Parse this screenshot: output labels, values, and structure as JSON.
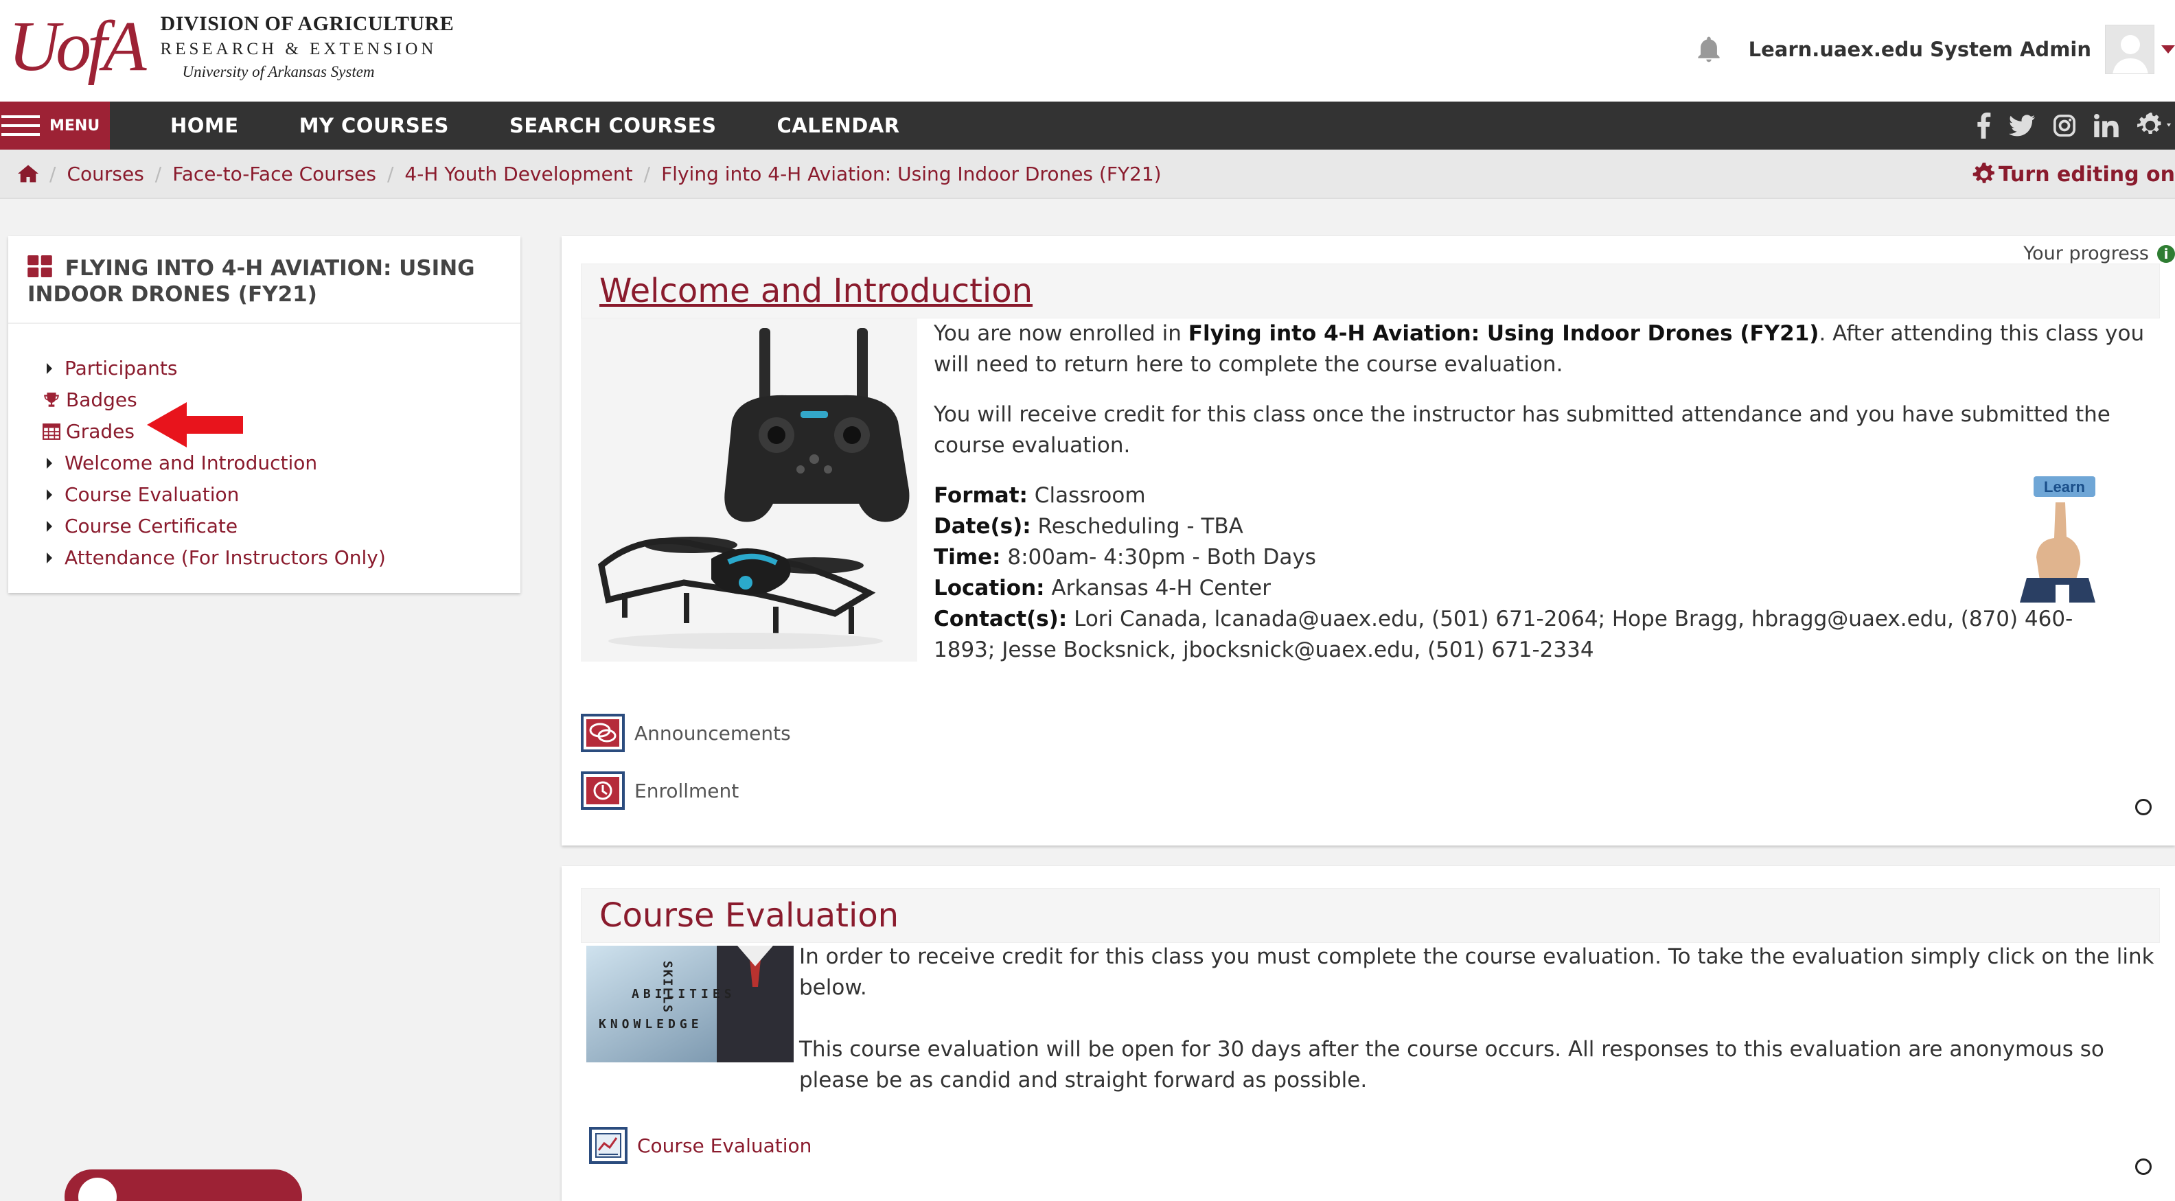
{
  "header": {
    "logo": {
      "mark": "UofA",
      "line1": "DIVISION OF AGRICULTURE",
      "line2": "RESEARCH & EXTENSION",
      "line3": "University of Arkansas System"
    },
    "user_name": "Learn.uaex.edu System Admin",
    "icons": {
      "bell": "bell-icon",
      "avatar": "user-avatar-icon",
      "caret": "caret-down-icon"
    }
  },
  "nav": {
    "menu_label": "MENU",
    "items": [
      "HOME",
      "MY COURSES",
      "SEARCH COURSES",
      "CALENDAR"
    ],
    "social": [
      "facebook-icon",
      "twitter-icon",
      "instagram-icon",
      "linkedin-icon",
      "gear-icon"
    ]
  },
  "breadcrumb": {
    "items": [
      "Courses",
      "Face-to-Face Courses",
      "4-H Youth Development",
      "Flying into 4-H Aviation: Using Indoor Drones (FY21)"
    ],
    "sep": "/",
    "edit_label": "Turn editing on"
  },
  "sidebar": {
    "title": "FLYING INTO 4-H AVIATION: USING INDOOR DRONES (FY21)",
    "items": [
      {
        "label": "Participants",
        "icon": "triangle-right-icon"
      },
      {
        "label": "Badges",
        "icon": "trophy-icon"
      },
      {
        "label": "Grades",
        "icon": "table-icon"
      },
      {
        "label": "Welcome and Introduction",
        "icon": "triangle-right-icon"
      },
      {
        "label": "Course Evaluation",
        "icon": "triangle-right-icon"
      },
      {
        "label": "Course Certificate",
        "icon": "triangle-right-icon"
      },
      {
        "label": "Attendance (For Instructors Only)",
        "icon": "triangle-right-icon"
      }
    ]
  },
  "main": {
    "progress_label": "Your progress",
    "progress_icon": "i",
    "welcome": {
      "title": "Welcome and Introduction",
      "p1_prefix": "You are now enrolled in ",
      "p1_course": "Flying into 4-H Aviation: Using Indoor Drones (FY21)",
      "p1_suffix": ".  After attending this class you will need to return here to complete the course evaluation.",
      "p2": "You will receive credit for this class once the instructor has submitted attendance and you have submitted the course evaluation.",
      "format_label": "Format:",
      "format": " Classroom",
      "dates_label": "Date(s):",
      "dates": " Rescheduling - TBA",
      "time_label": "Time:",
      "time": " 8:00am- 4:30pm - Both Days",
      "location_label": "Location:",
      "location": " Arkansas 4-H Center",
      "contacts_label": "Contact(s):",
      "contacts": " Lori Canada, lcanada@uaex.edu, (501) 671-2064; Hope Bragg, hbragg@uaex.edu, (870) 460-1893; Jesse Bocksnick, jbocksnick@uaex.edu, (501) 671-2334",
      "learn_badge": "Learn",
      "activities": [
        "Announcements",
        "Enrollment"
      ]
    },
    "evaluation": {
      "title": "Course Evaluation",
      "p1": "In order to receive credit for this class you must complete the course evaluation.  To take the evaluation simply click on the link below.",
      "p2": "This course evaluation will be open for 30 days after the course occurs.  All responses to this evaluation are anonymous so please be as candid and straight forward as possible.",
      "skills_words": [
        "SKILLS",
        "ABILITIES",
        "KNOWLEDGE"
      ],
      "activity": "Course Evaluation"
    }
  },
  "colors": {
    "brand": "#9d2235",
    "link": "#8a1b2d",
    "navbar": "#333333"
  }
}
